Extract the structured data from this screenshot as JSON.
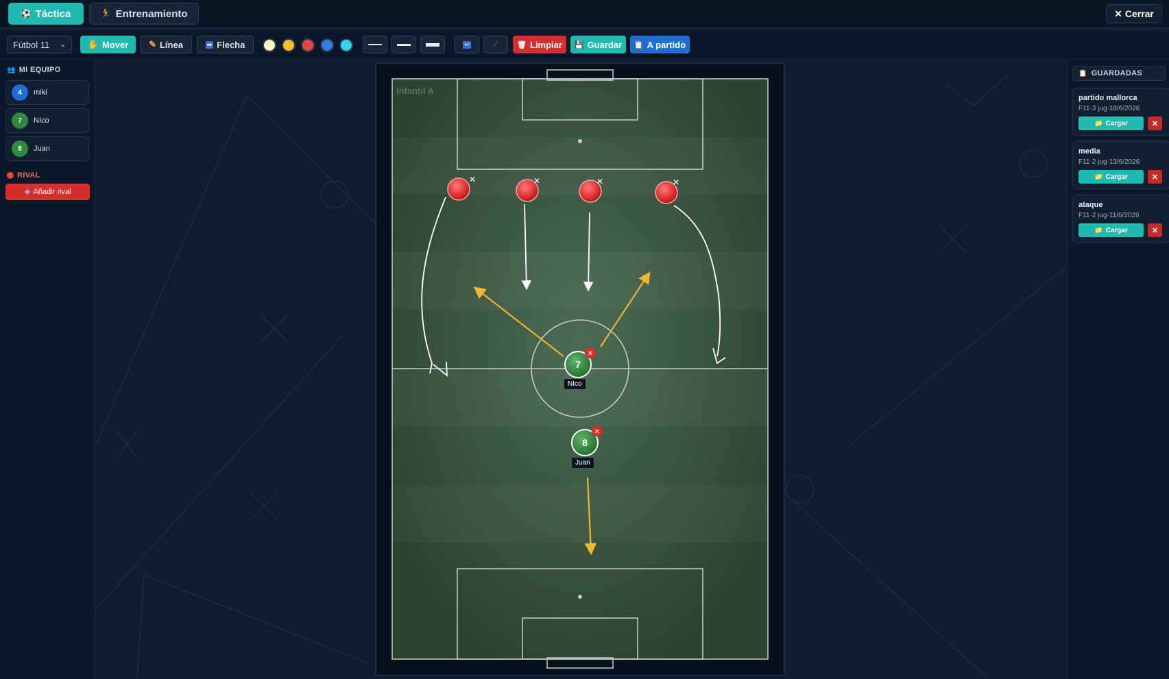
{
  "header": {
    "tabs": [
      {
        "label": "Táctica",
        "icon": "soccer-ball-icon"
      },
      {
        "label": "Entrenamiento",
        "icon": "running-icon"
      }
    ],
    "close_label": "Cerrar"
  },
  "toolbar": {
    "format": "Fútbol 11",
    "mover": "Mover",
    "linea": "Línea",
    "flecha": "Flecha",
    "colors": [
      "#fff7c2",
      "#f3c22b",
      "#e84545",
      "#2f7de1",
      "#35d6e8"
    ],
    "limpiar": "Limpiar",
    "guardar": "Guardar",
    "a_partido": "A partido"
  },
  "left_sidebar": {
    "team_title": "MI EQUIPO",
    "players": [
      {
        "number": "4",
        "name": "miki",
        "color": "#1e6fd0"
      },
      {
        "number": "7",
        "name": "NIco",
        "color": "#2f8a3e"
      },
      {
        "number": "8",
        "name": "Juan",
        "color": "#2f8a3e"
      }
    ],
    "rival_title": "RIVAL",
    "add_rival": "Añadir rival"
  },
  "pitch": {
    "label": "Infantil A",
    "players": [
      {
        "number": "7",
        "name": "NIco"
      },
      {
        "number": "8",
        "name": "Juan"
      }
    ]
  },
  "right_sidebar": {
    "title": "GUARDADAS",
    "saves": [
      {
        "name": "partido mallorca",
        "meta": "F11·3 jug·18/6/2026",
        "load": "Cargar"
      },
      {
        "name": "media",
        "meta": "F11·2 jug·13/6/2026",
        "load": "Cargar"
      },
      {
        "name": "ataque",
        "meta": "F11·2 jug·11/6/2026",
        "load": "Cargar"
      }
    ]
  }
}
